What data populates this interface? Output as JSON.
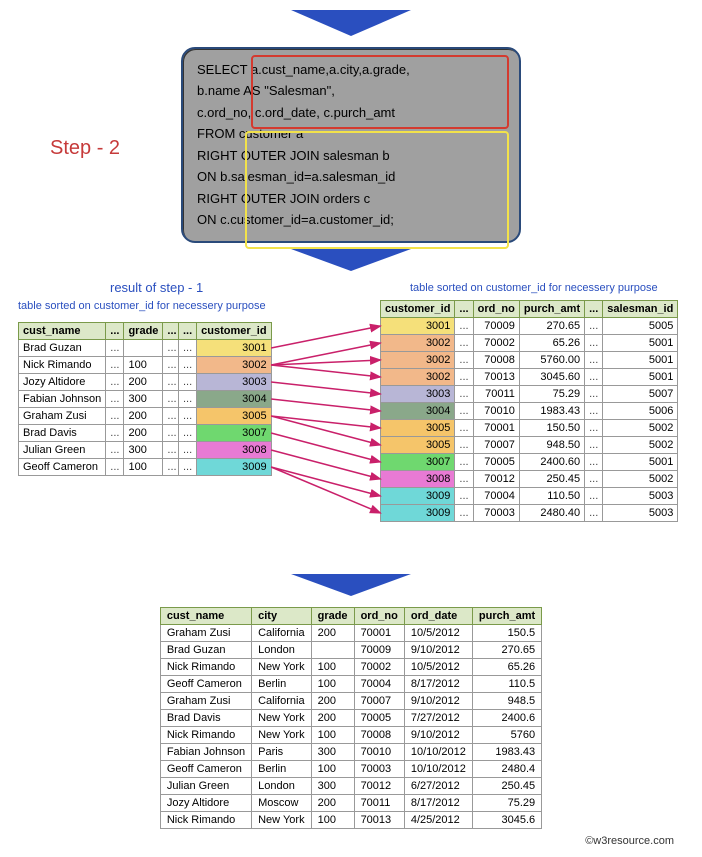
{
  "step_label": "Step - 2",
  "sql": {
    "l1": "SELECT  a.cust_name,a.city,a.grade,",
    "l2": "b.name AS \"Salesman\",",
    "l3": "c.ord_no, c.ord_date, c.purch_amt",
    "l4": "FROM   customer a",
    "l5": "RIGHT OUTER JOIN salesman b",
    "l6": "ON b.salesman_id=a.salesman_id",
    "l7": "RIGHT OUTER JOIN orders c",
    "l8": "ON c.customer_id=a.customer_id;"
  },
  "captions": {
    "left_title": "result of step - 1",
    "left_sub": "table sorted on customer_id for necessery purpose",
    "right": "table sorted on customer_id for necessery purpose"
  },
  "left1": {
    "headers": [
      "cust_name",
      "...",
      "grade",
      "..."
    ],
    "rows": [
      [
        "Brad Guzan",
        "...",
        "",
        "..."
      ],
      [
        "Nick Rimando",
        "...",
        "100",
        "..."
      ],
      [
        "Jozy Altidore",
        "...",
        "200",
        "..."
      ],
      [
        "Fabian Johnson",
        "...",
        "300",
        "..."
      ],
      [
        "Graham Zusi",
        "...",
        "200",
        "..."
      ],
      [
        "Brad Davis",
        "...",
        "200",
        "..."
      ],
      [
        "Julian Green",
        "...",
        "300",
        "..."
      ],
      [
        "Geoff Cameron",
        "...",
        "100",
        "..."
      ]
    ]
  },
  "left2": {
    "headers": [
      "...",
      "customer_id"
    ],
    "rows": [
      {
        "d": "...",
        "v": "3001",
        "c": "c3001"
      },
      {
        "d": "...",
        "v": "3002",
        "c": "c3002"
      },
      {
        "d": "...",
        "v": "3003",
        "c": "c3003"
      },
      {
        "d": "...",
        "v": "3004",
        "c": "c3004"
      },
      {
        "d": "...",
        "v": "3005",
        "c": "c3005"
      },
      {
        "d": "...",
        "v": "3007",
        "c": "c3007"
      },
      {
        "d": "...",
        "v": "3008",
        "c": "c3008"
      },
      {
        "d": "...",
        "v": "3009",
        "c": "c3009"
      }
    ]
  },
  "right": {
    "headers": [
      "customer_id",
      "...",
      "ord_no",
      "purch_amt",
      "...",
      "salesman_id"
    ],
    "rows": [
      {
        "cid": "3001",
        "c": "c3001",
        "ord": "70009",
        "amt": "270.65",
        "sid": "5005"
      },
      {
        "cid": "3002",
        "c": "c3002",
        "ord": "70002",
        "amt": "65.26",
        "sid": "5001"
      },
      {
        "cid": "3002",
        "c": "c3002",
        "ord": "70008",
        "amt": "5760.00",
        "sid": "5001"
      },
      {
        "cid": "3002",
        "c": "c3002",
        "ord": "70013",
        "amt": "3045.60",
        "sid": "5001"
      },
      {
        "cid": "3003",
        "c": "c3003",
        "ord": "70011",
        "amt": "75.29",
        "sid": "5007"
      },
      {
        "cid": "3004",
        "c": "c3004",
        "ord": "70010",
        "amt": "1983.43",
        "sid": "5006"
      },
      {
        "cid": "3005",
        "c": "c3005",
        "ord": "70001",
        "amt": "150.50",
        "sid": "5002"
      },
      {
        "cid": "3005",
        "c": "c3005",
        "ord": "70007",
        "amt": "948.50",
        "sid": "5002"
      },
      {
        "cid": "3007",
        "c": "c3007",
        "ord": "70005",
        "amt": "2400.60",
        "sid": "5001"
      },
      {
        "cid": "3008",
        "c": "c3008",
        "ord": "70012",
        "amt": "250.45",
        "sid": "5002"
      },
      {
        "cid": "3009",
        "c": "c3009",
        "ord": "70004",
        "amt": "110.50",
        "sid": "5003"
      },
      {
        "cid": "3009",
        "c": "c3009",
        "ord": "70003",
        "amt": "2480.40",
        "sid": "5003"
      }
    ]
  },
  "result": {
    "headers": [
      "cust_name",
      "city",
      "grade",
      "ord_no",
      "ord_date",
      "purch_amt"
    ],
    "rows": [
      [
        "Graham Zusi",
        "California",
        "200",
        "70001",
        "10/5/2012",
        "150.5"
      ],
      [
        "Brad Guzan",
        "London",
        "",
        "70009",
        "9/10/2012",
        "270.65"
      ],
      [
        "Nick Rimando",
        "New York",
        "100",
        "70002",
        "10/5/2012",
        "65.26"
      ],
      [
        "Geoff Cameron",
        "Berlin",
        "100",
        "70004",
        "8/17/2012",
        "110.5"
      ],
      [
        "Graham Zusi",
        "California",
        "200",
        "70007",
        "9/10/2012",
        "948.5"
      ],
      [
        "Brad Davis",
        "New York",
        "200",
        "70005",
        "7/27/2012",
        "2400.6"
      ],
      [
        "Nick Rimando",
        "New York",
        "100",
        "70008",
        "9/10/2012",
        "5760"
      ],
      [
        "Fabian Johnson",
        "Paris",
        "300",
        "70010",
        "10/10/2012",
        "1983.43"
      ],
      [
        "Geoff Cameron",
        "Berlin",
        "100",
        "70003",
        "10/10/2012",
        "2480.4"
      ],
      [
        "Julian Green",
        "London",
        "300",
        "70012",
        "6/27/2012",
        "250.45"
      ],
      [
        "Jozy Altidore",
        "Moscow",
        "200",
        "70011",
        "8/17/2012",
        "75.29"
      ],
      [
        "Nick Rimando",
        "New York",
        "100",
        "70013",
        "4/25/2012",
        "3045.6"
      ]
    ]
  },
  "credit": "©w3resource.com"
}
